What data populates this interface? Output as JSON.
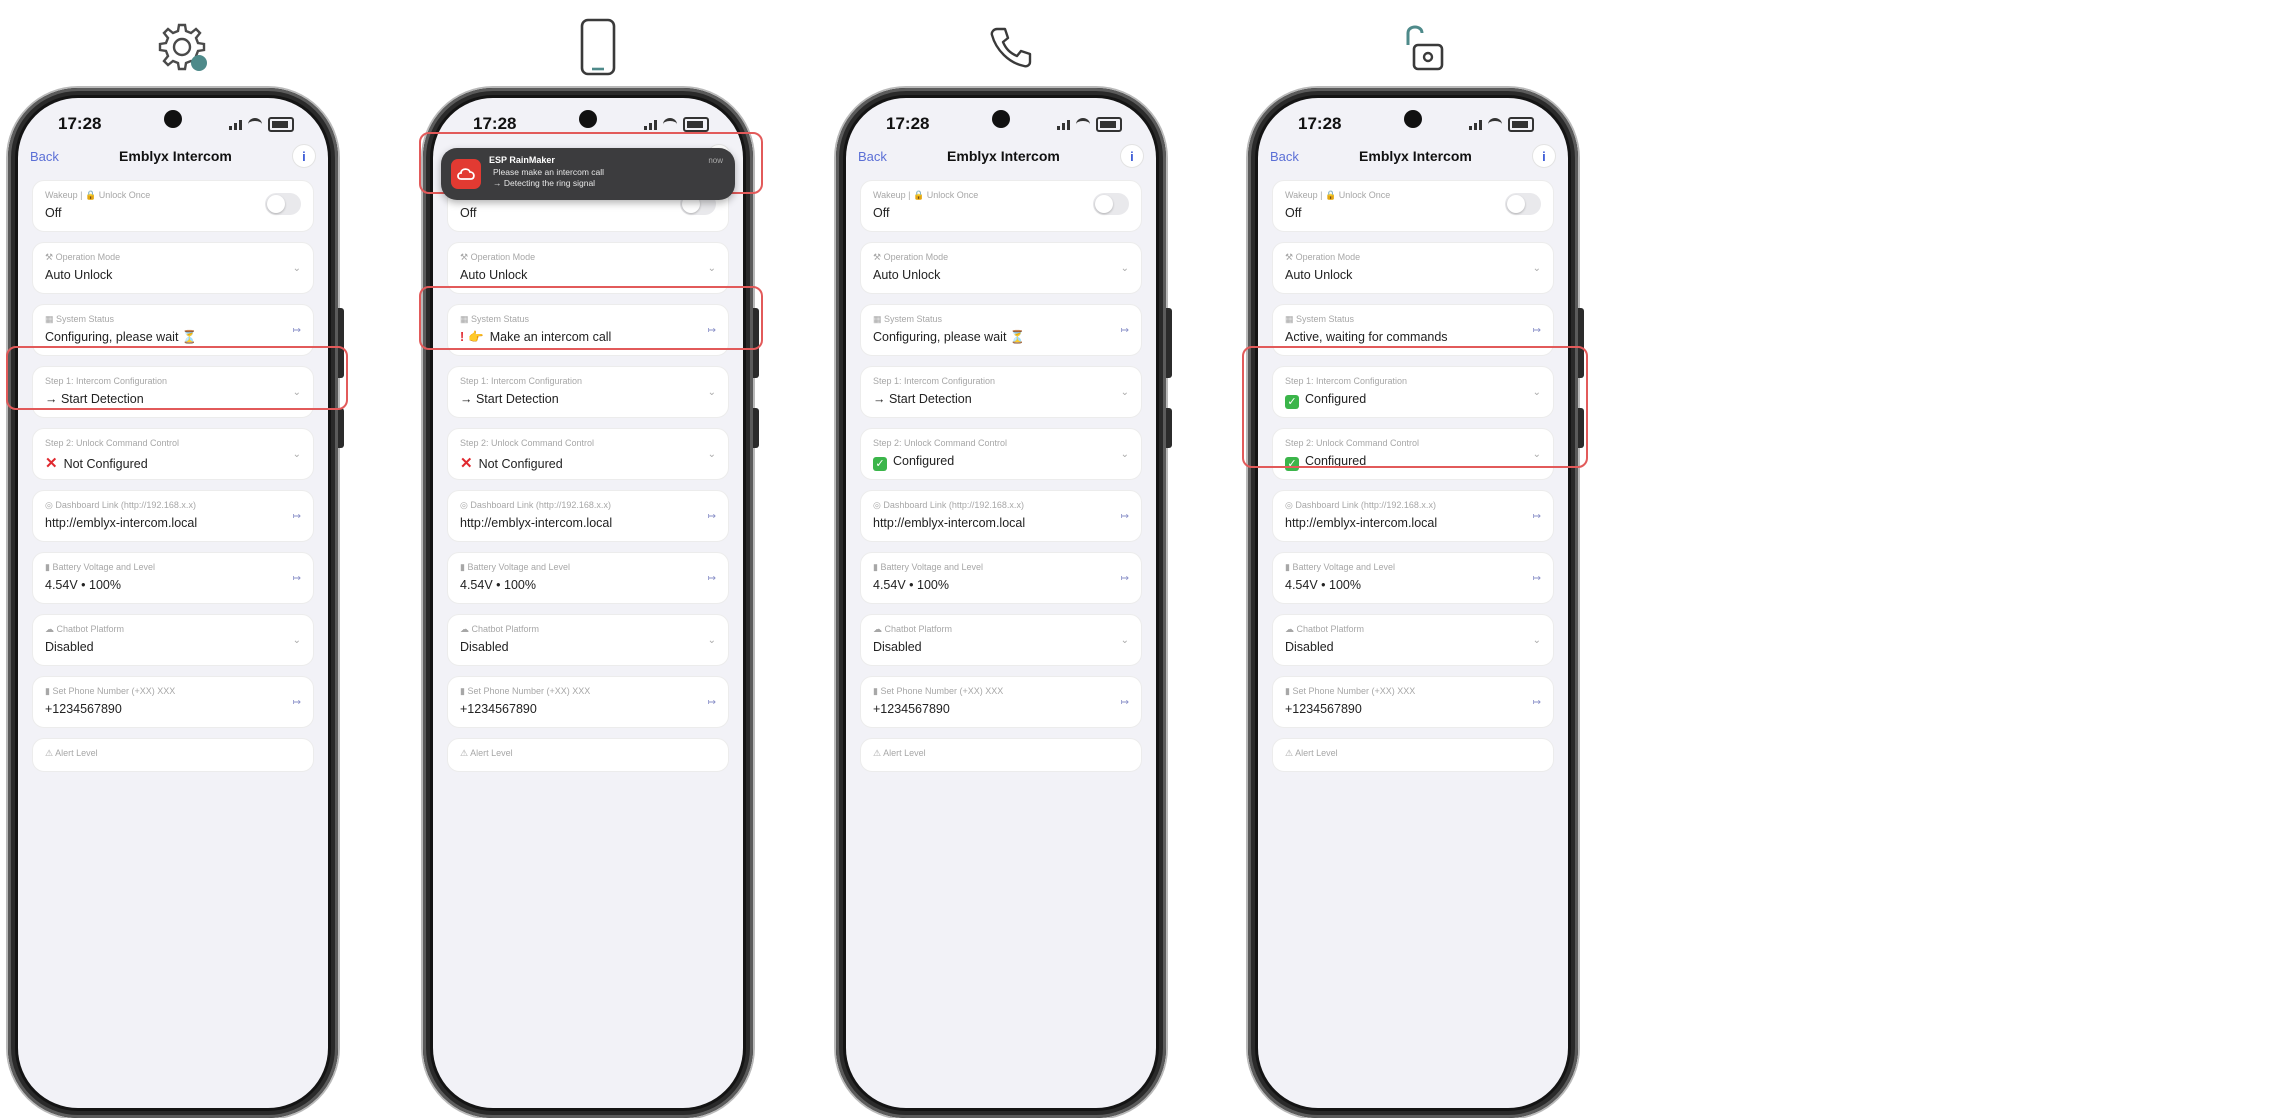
{
  "status_bar": {
    "time": "17:28"
  },
  "nav": {
    "back": "Back",
    "title": "Emblyx Intercom",
    "info": "i"
  },
  "steps": [
    {
      "icon": "gear-icon"
    },
    {
      "icon": "phone-icon"
    },
    {
      "icon": "call-icon"
    },
    {
      "icon": "unlock-icon"
    }
  ],
  "labels": {
    "wakeup": "Wakeup | 🔒 Unlock Once",
    "mode": "⚒ Operation Mode",
    "status": "▦ System Status",
    "step1": "Step 1: Intercom Configuration",
    "step2": "Step 2: Unlock Command Control",
    "dashboard": "◎ Dashboard Link (http://192.168.x.x)",
    "battery": "▮ Battery Voltage and Level",
    "chatbot": "☁ Chatbot Platform",
    "phone": "▮ Set Phone Number (+XX) XXX",
    "alert": "⚠ Alert Level"
  },
  "values": {
    "off": "Off",
    "auto": "Auto Unlock",
    "configuring": "Configuring, please wait ⏳",
    "make_call": "Make an intercom call",
    "active": "Active, waiting for commands",
    "start": "→ Start Detection",
    "not_configured": "Not Configured",
    "configured": "Configured",
    "url": "http://emblyx-intercom.local",
    "voltage": "4.54V • 100%",
    "disabled": "Disabled",
    "phone": "+1234567890"
  },
  "notification": {
    "app": "ESP RainMaker",
    "line1": "Please make an intercom call",
    "line2": "→ Detecting the ring signal",
    "time": "now"
  },
  "colors": {
    "highlight": "#e25a5a",
    "accent": "#5b6fd6",
    "check": "#3bb54a",
    "cross": "#e0292f"
  }
}
